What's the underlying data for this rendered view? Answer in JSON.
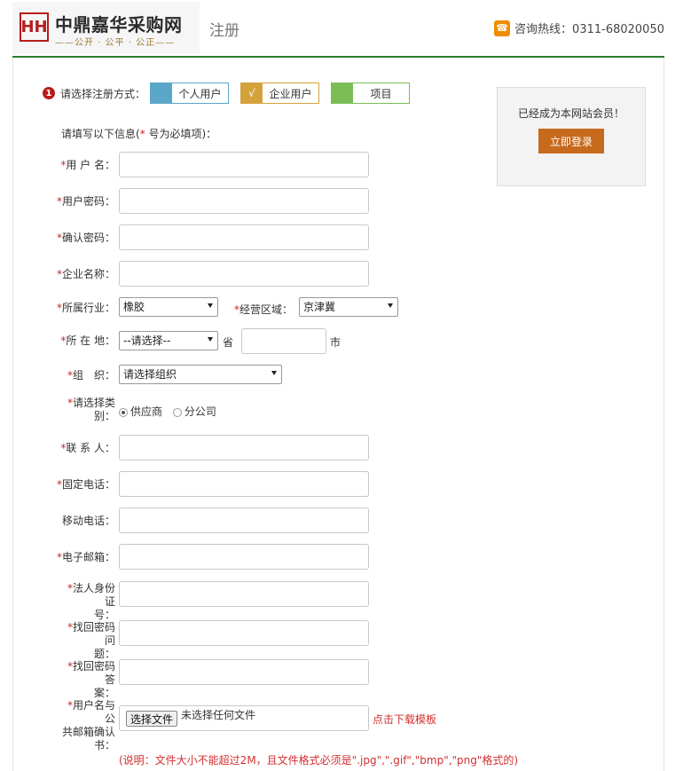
{
  "header": {
    "logo_mark": "HH",
    "logo_title": "中鼎嘉华采购网",
    "logo_sub": "——公开 · 公平 · 公正——",
    "page_name": "注册",
    "hotline_label": "咨询热线：0311-68020050",
    "phone_icon": "phone-icon"
  },
  "step": {
    "num": "1",
    "label": "请选择注册方式：",
    "types": [
      {
        "label": "个人用户",
        "mark": "",
        "color": "#5aa7c9"
      },
      {
        "label": "企业用户",
        "mark": "√",
        "color": "#d4a23a"
      },
      {
        "label": "项目",
        "mark": "",
        "color": "#7bbd55"
      }
    ]
  },
  "intro": {
    "prefix": "请填写以下信息(",
    "star": "*",
    "suffix": " 号为必填项)："
  },
  "fields": {
    "username": "用 户 名：",
    "password": "用户密码：",
    "confirm": "确认密码：",
    "company": "企业名称：",
    "industry": "所属行业：",
    "region": "经营区域：",
    "location": "所 在 地：",
    "org": "组　织：",
    "category_line1": "请选择类",
    "category_line2": "别：",
    "contact": "联 系 人：",
    "phone": "固定电话：",
    "mobile": "移动电话：",
    "email": "电子邮箱：",
    "idcard_line1": "法人身份证",
    "idcard_line2": "号：",
    "question_line1": "找回密码问",
    "question_line2": "题：",
    "answer_line1": "找回密码答",
    "answer_line2": "案：",
    "confirmbook_line1": "用户名与公",
    "confirmbook_line2": "共邮箱确认",
    "confirmbook_line3": "书："
  },
  "selects": {
    "industry": "橡胶",
    "region": "京津冀",
    "province": "--请选择--",
    "province_unit": "省",
    "city_unit": "市",
    "org": "请选择组织"
  },
  "category": {
    "option1": "供应商",
    "option2": "分公司"
  },
  "file": {
    "button": "选择文件",
    "status": "未选择任何文件",
    "download": "点击下载模板"
  },
  "note": "(说明：文件大小不能超过2M，且文件格式必须是\".jpg\",\".gif\",\"bmp\",\"png\"格式的)",
  "side": {
    "text": "已经成为本网站会员！",
    "login": "立即登录"
  },
  "colors": {
    "accent_green": "#2e7d32",
    "required": "#c62828",
    "login": "#c86a1d"
  }
}
